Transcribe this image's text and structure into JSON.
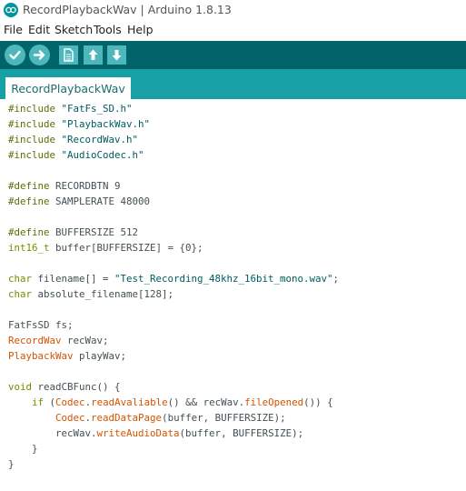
{
  "window": {
    "title": "RecordPlaybackWav | Arduino 1.8.13"
  },
  "menu": [
    "File",
    "Edit",
    "Sketch",
    "Tools",
    "Help"
  ],
  "toolbar": {
    "buttons": [
      "verify-icon",
      "upload-icon",
      "new-icon",
      "open-icon",
      "save-icon"
    ]
  },
  "tab": {
    "label": "RecordPlaybackWav"
  },
  "colors": {
    "toolbar": "#006468",
    "tabstrip": "#17a1a5",
    "button": "#4db7bb",
    "keyword_type": "#728e00",
    "class_name": "#d35400",
    "string": "#005c5f",
    "default_text": "#434f54"
  },
  "code": {
    "l1": {
      "a": "#include",
      "b": " ",
      "c": "\"FatFs_SD.h\""
    },
    "l2": {
      "a": "#include",
      "b": " ",
      "c": "\"PlaybackWav.h\""
    },
    "l3": {
      "a": "#include",
      "b": " ",
      "c": "\"RecordWav.h\""
    },
    "l4": {
      "a": "#include",
      "b": " ",
      "c": "\"AudioCodec.h\""
    },
    "l6": {
      "a": "#define",
      "b": " RECORDBTN 9"
    },
    "l7": {
      "a": "#define",
      "b": " SAMPLERATE 48000"
    },
    "l9": {
      "a": "#define",
      "b": " BUFFERSIZE 512"
    },
    "l10": {
      "a": "int16_t",
      "b": " ",
      "c": "buffer",
      "d": "[BUFFERSIZE] = {0};"
    },
    "l12": {
      "a": "char",
      "b": " filename[] = ",
      "c": "\"Test_Recording_48khz_16bit_mono.wav\"",
      "d": ";"
    },
    "l13": {
      "a": "char",
      "b": " absolute_filename[128];"
    },
    "l15": {
      "a": "FatFsSD fs;"
    },
    "l16": {
      "a": "RecordWav",
      "b": " recWav;"
    },
    "l17": {
      "a": "PlaybackWav",
      "b": " playWav;"
    },
    "l19": {
      "a": "void",
      "b": " readCBFunc() {"
    },
    "l20": {
      "a": "    ",
      "b": "if",
      "c": " (",
      "d": "Codec",
      "e": ".",
      "f": "readAvaliable",
      "g": "() && recWav.",
      "h": "fileOpened",
      "i": "()) {"
    },
    "l21": {
      "a": "        ",
      "b": "Codec",
      "c": ".",
      "d": "readDataPage",
      "e": "(",
      "f": "buffer",
      "g": ", BUFFERSIZE);"
    },
    "l22": {
      "a": "        recWav.",
      "b": "writeAudioData",
      "c": "(",
      "d": "buffer",
      "e": ", BUFFERSIZE);"
    },
    "l23": {
      "a": "    }"
    },
    "l24": {
      "a": "}"
    }
  }
}
